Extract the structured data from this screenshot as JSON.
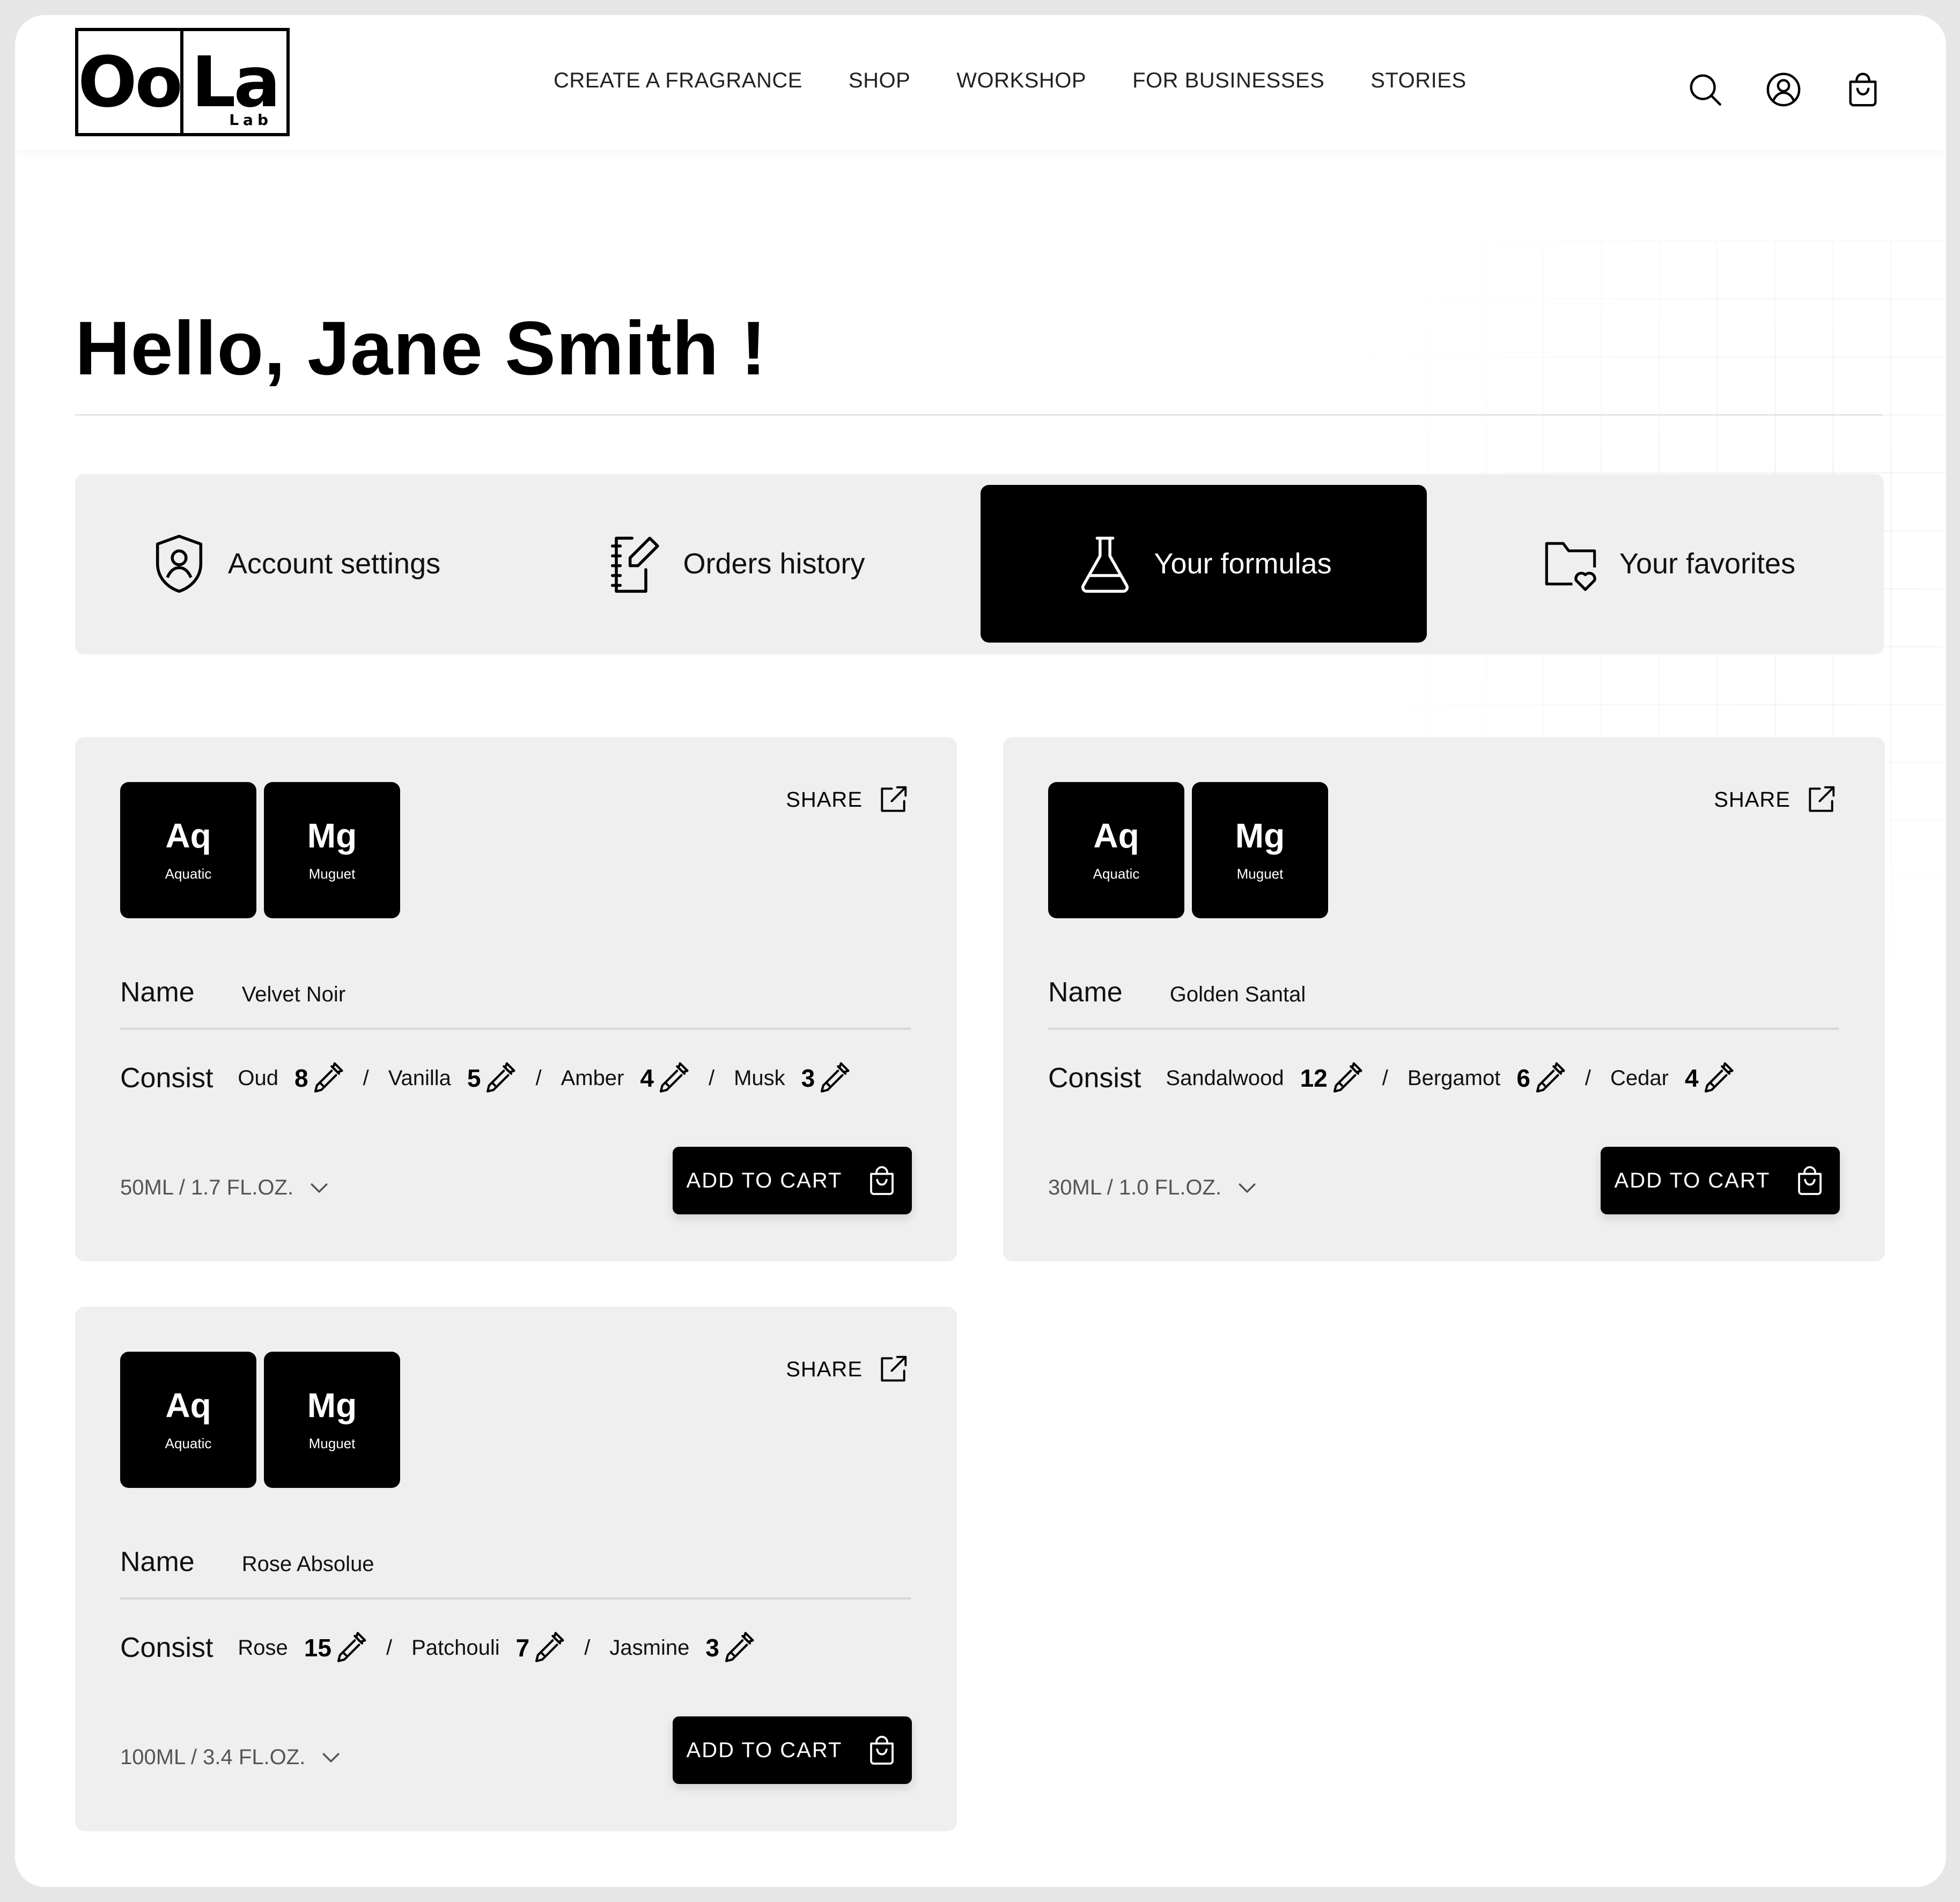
{
  "brand": {
    "logo_left": "Oo",
    "logo_right": "La",
    "logo_sub": "Lab"
  },
  "nav": [
    "CREATE A FRAGRANCE",
    "SHOP",
    "WORKSHOP",
    "FOR BUSINESSES",
    "STORIES"
  ],
  "header_icons": [
    "search-icon",
    "user-icon",
    "cart-icon"
  ],
  "greeting": "Hello, Jane Smith !",
  "tabs": [
    {
      "label": "Account settings",
      "icon": "shield-user-icon",
      "active": false
    },
    {
      "label": "Orders history",
      "icon": "notebook-pen-icon",
      "active": false
    },
    {
      "label": "Your formulas",
      "icon": "flask-icon",
      "active": true
    },
    {
      "label": "Your favorites",
      "icon": "folder-heart-icon",
      "active": false
    }
  ],
  "labels": {
    "share": "SHARE",
    "name": "Name",
    "consist": "Consist",
    "add_to_cart": "ADD TO CART",
    "separator": "/"
  },
  "formulas": [
    {
      "tiles": [
        {
          "symbol": "Aq",
          "name": "Aquatic"
        },
        {
          "symbol": "Mg",
          "name": "Muguet"
        }
      ],
      "name": "Velvet Noir",
      "ingredients": [
        {
          "name": "Oud",
          "qty": "8"
        },
        {
          "name": "Vanilla",
          "qty": "5"
        },
        {
          "name": "Amber",
          "qty": "4"
        },
        {
          "name": "Musk",
          "qty": "3"
        }
      ],
      "size": "50ML / 1.7 FL.OZ."
    },
    {
      "tiles": [
        {
          "symbol": "Aq",
          "name": "Aquatic"
        },
        {
          "symbol": "Mg",
          "name": "Muguet"
        }
      ],
      "name": "Golden Santal",
      "ingredients": [
        {
          "name": "Sandalwood",
          "qty": "12"
        },
        {
          "name": "Bergamot",
          "qty": "6"
        },
        {
          "name": "Cedar",
          "qty": "4"
        }
      ],
      "size": "30ML / 1.0 FL.OZ."
    },
    {
      "tiles": [
        {
          "symbol": "Aq",
          "name": "Aquatic"
        },
        {
          "symbol": "Mg",
          "name": "Muguet"
        }
      ],
      "name": "Rose Absolue",
      "ingredients": [
        {
          "name": "Rose",
          "qty": "15"
        },
        {
          "name": "Patchouli",
          "qty": "7"
        },
        {
          "name": "Jasmine",
          "qty": "3"
        }
      ],
      "size": "100ML / 3.4 FL.OZ."
    }
  ]
}
